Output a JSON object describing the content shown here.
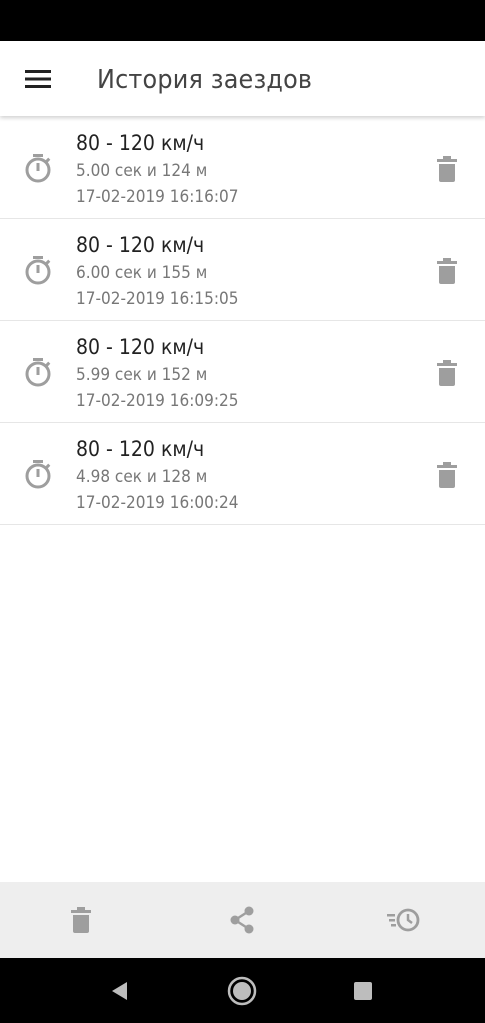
{
  "app_bar": {
    "title": "История заездов",
    "menu_icon": "hamburger-menu-icon"
  },
  "runs": [
    {
      "title": "80 - 120 км/ч",
      "result": "5.00 сек и 124 м",
      "date": "17-02-2019 16:16:07"
    },
    {
      "title": "80 - 120 км/ч",
      "result": "6.00 сек и 155 м",
      "date": "17-02-2019 16:15:05"
    },
    {
      "title": "80 - 120 км/ч",
      "result": "5.99 сек и 152 м",
      "date": "17-02-2019 16:09:25"
    },
    {
      "title": "80 - 120 км/ч",
      "result": "4.98 сек и 128 м",
      "date": "17-02-2019 16:00:24"
    }
  ],
  "row_icons": {
    "leading": "stopwatch-icon",
    "trailing": "trash-icon"
  },
  "bottom_toolbar": [
    "trash-icon",
    "share-icon",
    "history-icon"
  ],
  "nav_bar": [
    "back-triangle-icon",
    "home-circle-icon",
    "recents-square-icon"
  ],
  "colors": {
    "icon_gray": "#9e9e9e",
    "title_text": "#444444",
    "toolbar_bg": "#eeeeee"
  }
}
